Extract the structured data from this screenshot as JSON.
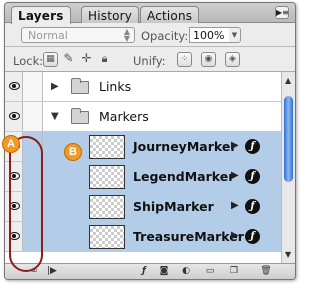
{
  "tabs": [
    "Layers",
    "History",
    "Actions"
  ],
  "controls": {
    "blend_mode": "Normal",
    "opacity_label": "Opacity:",
    "opacity_value": "100%",
    "lock_label": "Lock:",
    "unify_label": "Unify:"
  },
  "layers": [
    {
      "name": "Links",
      "type": "group",
      "expanded": false
    },
    {
      "name": "Markers",
      "type": "group",
      "expanded": true
    },
    {
      "name": "JourneyMarker",
      "type": "layer",
      "selected": true
    },
    {
      "name": "LegendMarker",
      "type": "layer",
      "selected": true
    },
    {
      "name": "ShipMarker",
      "type": "layer",
      "selected": true
    },
    {
      "name": "TreasureMarker",
      "type": "layer",
      "selected": true
    }
  ],
  "annotations": {
    "a": "A",
    "b": "B"
  },
  "colors": {
    "selection": "#b3cde9",
    "callout": "#f39a25",
    "oval": "#8a1d1d",
    "scroll_thumb": "#2e6fd1"
  },
  "icons": [
    "flyout-menu-icon",
    "lock-transparency-icon",
    "lock-brush-icon",
    "lock-move-icon",
    "lock-all-icon",
    "unify-position-icon",
    "unify-visibility-icon",
    "unify-style-icon",
    "eye-icon",
    "chain-link-icon",
    "layer-style-icon",
    "mask-icon",
    "new-group-icon",
    "new-layer-icon",
    "trash-icon"
  ]
}
